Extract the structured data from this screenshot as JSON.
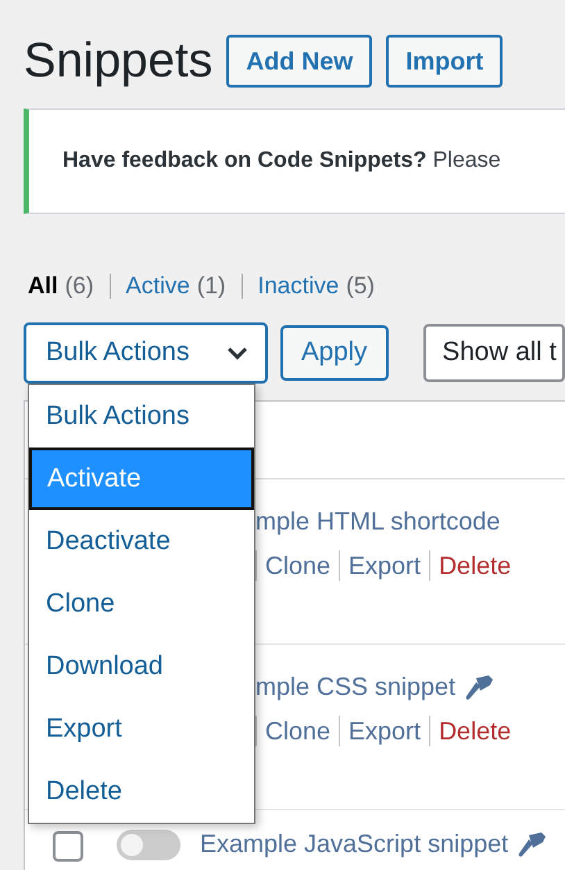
{
  "page_title": "Snippets",
  "header_buttons": [
    "Add New",
    "Import"
  ],
  "notice": {
    "text": "**Have feedback on Code Snippets?** Please"
  },
  "filters": [
    {
      "label": "All",
      "count": "(6)",
      "selected": true
    },
    {
      "label": "Active",
      "count": "(1)",
      "selected": false
    },
    {
      "label": "Inactive",
      "count": "(5)",
      "selected": false
    }
  ],
  "bulk_select": {
    "value": "Bulk Actions",
    "expanded": true
  },
  "apply_button": "Apply",
  "tags_select": {
    "value": "Show all t"
  },
  "bulk_options": [
    {
      "label": "Bulk Actions",
      "selected": false
    },
    {
      "label": "Activate",
      "selected": true
    },
    {
      "label": "Deactivate",
      "selected": false
    },
    {
      "label": "Clone",
      "selected": false
    },
    {
      "label": "Download",
      "selected": false
    },
    {
      "label": "Export",
      "selected": false
    },
    {
      "label": "Delete",
      "selected": false
    }
  ],
  "rows": [
    {
      "name": "mple HTML shortcode",
      "pinned": false,
      "actions": [
        {
          "label": "Clone",
          "kind": "link"
        },
        {
          "label": "Export",
          "kind": "link"
        },
        {
          "label": "Delete",
          "kind": "danger"
        }
      ]
    },
    {
      "name": "mple CSS snippet",
      "pinned": true,
      "actions": [
        {
          "label": "Clone",
          "kind": "link"
        },
        {
          "label": "Export",
          "kind": "link"
        },
        {
          "label": "Delete",
          "kind": "danger"
        }
      ]
    },
    {
      "name": "Example JavaScript snippet",
      "pinned": true,
      "checked": false,
      "on": false
    }
  ]
}
